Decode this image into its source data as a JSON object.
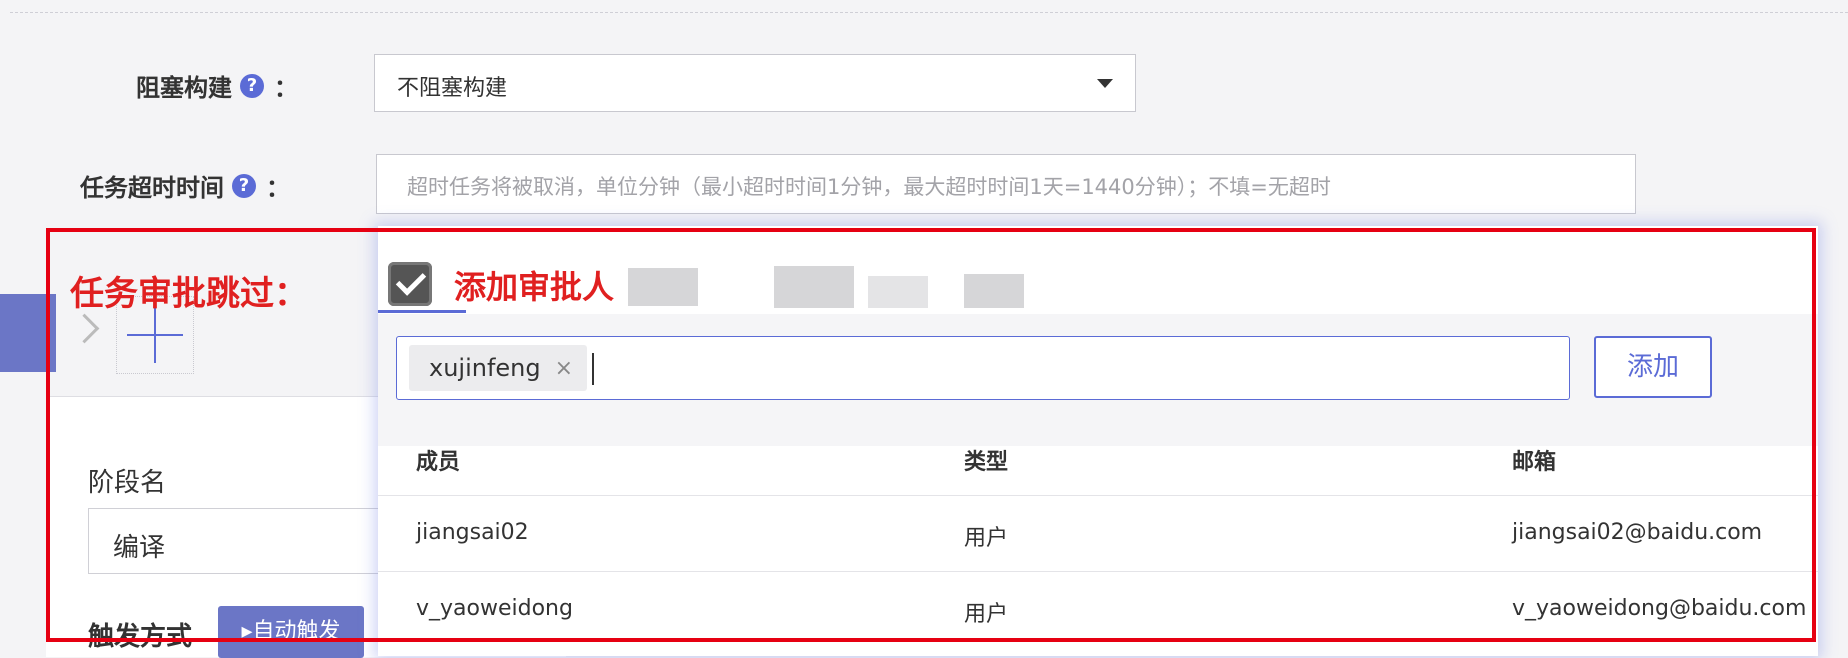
{
  "form": {
    "block_build": {
      "label": "阻塞构建",
      "colon": "：",
      "value": "不阻塞构建"
    },
    "task_timeout": {
      "label": "任务超时时间",
      "colon": "：",
      "placeholder": "超时任务将被取消，单位分钟（最小超时时间1分钟，最大超时时间1天=1440分钟）；不填=无超时"
    },
    "help_icon_glyph": "?"
  },
  "annotation": {
    "skip_label": "任务审批跳过："
  },
  "stage": {
    "name_label": "阶段名",
    "name_value": "编译",
    "trigger_label": "触发方式",
    "trigger_value": "▸自动触发"
  },
  "approver_popup": {
    "title": "添加审批人",
    "tag": {
      "value": "xujinfeng",
      "remove_glyph": "×"
    },
    "add_button": "添加",
    "table": {
      "headers": [
        "成员",
        "类型",
        "邮箱"
      ],
      "rows": [
        [
          "jiangsai02",
          "用户",
          "jiangsai02@baidu.com"
        ],
        [
          "v_yaoweidong",
          "用户",
          "v_yaoweidong@baidu.com"
        ]
      ]
    }
  },
  "colors": {
    "accent": "#5b6bd6",
    "annotation_red": "#e60012",
    "tab_purple": "#6b76c6"
  }
}
